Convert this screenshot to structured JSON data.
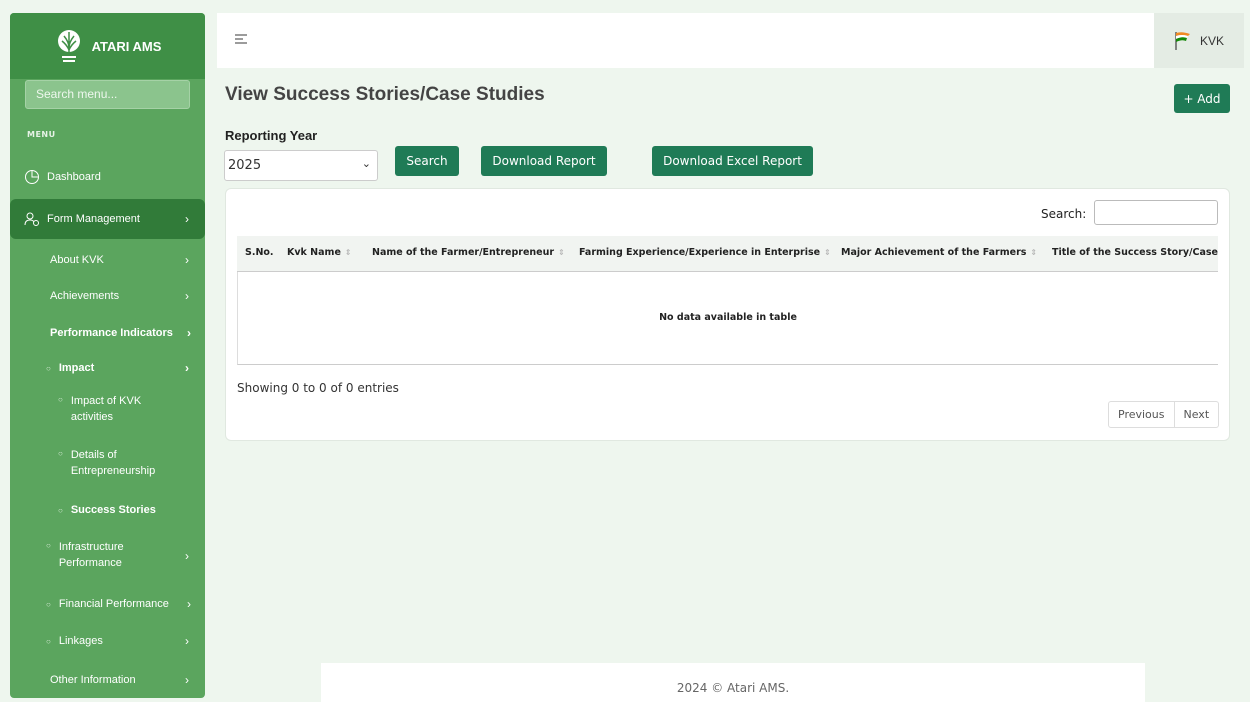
{
  "brand": {
    "name": "ATARI AMS"
  },
  "sidebar": {
    "search_placeholder": "Search menu...",
    "menu_heading": "MENU",
    "items": [
      {
        "label": "Dashboard"
      },
      {
        "label": "Form Management"
      },
      {
        "label": "About KVK"
      },
      {
        "label": "Achievements"
      },
      {
        "label": "Performance Indicators"
      },
      {
        "label": "Impact"
      },
      {
        "label": "Impact of KVK activities"
      },
      {
        "label": "Details of Entrepreneurship"
      },
      {
        "label": "Success Stories"
      },
      {
        "label": "Infrastructure Performance"
      },
      {
        "label": "Financial Performance"
      },
      {
        "label": "Linkages"
      },
      {
        "label": "Other Information"
      }
    ]
  },
  "topbar": {
    "user_label": "KVK"
  },
  "page": {
    "title": "View Success Stories/Case Studies",
    "add_label": "+ Add",
    "year_label": "Reporting Year",
    "year_value": "2025",
    "search_btn": "Search",
    "download_report": "Download Report",
    "download_excel": "Download Excel Report"
  },
  "table": {
    "search_label": "Search:",
    "columns": [
      "S.No.",
      "Kvk Name",
      "Name of the Farmer/Entrepreneur",
      "Farming Experience/Experience in Enterprise",
      "Major Achievement of the Farmers",
      "Title of the Success Story/Case S"
    ],
    "empty_text": "No data available in table",
    "info": "Showing 0 to 0 of 0 entries",
    "prev": "Previous",
    "next": "Next"
  },
  "footer": {
    "text": "2024 © Atari AMS."
  },
  "colors": {
    "sidebar": "#5ba55e",
    "brand_bar": "#3f8f46",
    "active_item": "#317b39",
    "button": "#1f7b56",
    "background": "#eef6ee"
  },
  "icons": [
    "wheat-emblem-icon",
    "hamburger-icon",
    "india-flag-icon",
    "pie-chart-icon",
    "users-gear-icon",
    "chevron-right-icon"
  ]
}
